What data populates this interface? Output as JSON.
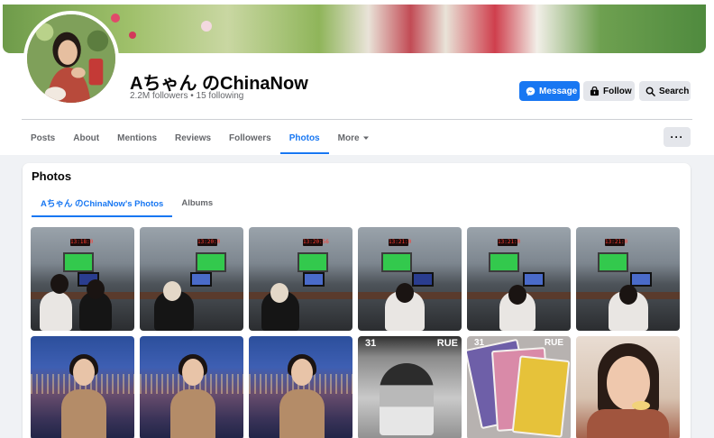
{
  "page": {
    "name": "Aちゃん のChinaNow",
    "followers_text": "2.2M followers • 15 following"
  },
  "actions": {
    "message": "Message",
    "follow": "Follow",
    "search": "Search",
    "more": "···"
  },
  "tabs": [
    {
      "label": "Posts"
    },
    {
      "label": "About"
    },
    {
      "label": "Mentions"
    },
    {
      "label": "Reviews"
    },
    {
      "label": "Followers"
    },
    {
      "label": "Photos",
      "active": true
    },
    {
      "label": "More"
    }
  ],
  "photos_section": {
    "title": "Photos",
    "subtabs": [
      {
        "label": "Aちゃん のChinaNow's Photos",
        "active": true
      },
      {
        "label": "Albums"
      }
    ]
  },
  "photo_grid": {
    "studio_clocks": [
      "13:18:0",
      "13:20:0",
      "13:20:56",
      "13:21:0",
      "13:21:0",
      "13:21:0"
    ],
    "magazine_text": [
      "31",
      "RUE"
    ],
    "cards_text": [
      "31",
      "RUE"
    ]
  },
  "colors": {
    "accent": "#1877f2",
    "muted_text": "#65676b",
    "button_gray": "#e4e6eb"
  },
  "icons": {
    "message": "messenger-icon",
    "follow": "follow-icon",
    "search": "search-icon",
    "more_tab": "caret-down-icon"
  }
}
